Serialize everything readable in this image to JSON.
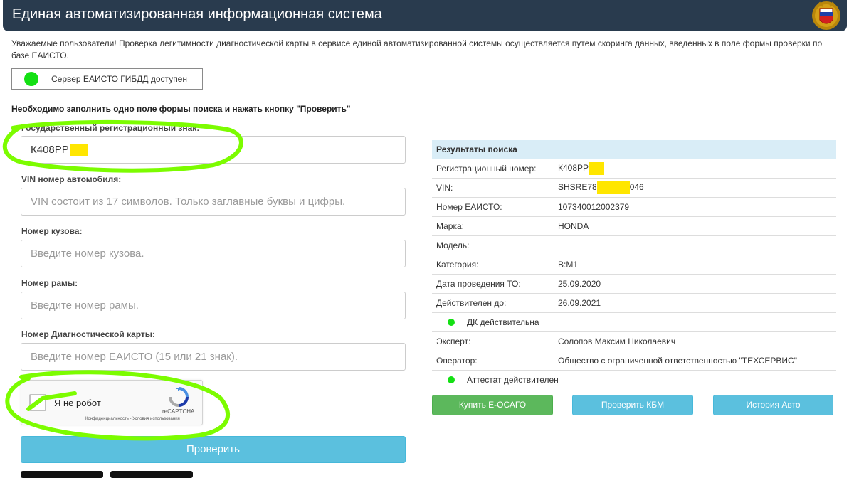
{
  "header": {
    "title": "Единая автоматизированная информационная система",
    "emblem_icon": "gibdd-emblem-icon"
  },
  "notice": "Уважаемые пользователи! Проверка легитимности диагностической карты в сервисе единой автоматизированной системы осуществляется путем скоринга данных, введенных в поле формы проверки по базе ЕАИСТО.",
  "server_status": {
    "text": "Сервер ЕАИСТО ГИБДД доступен",
    "status_color": "#14e014"
  },
  "instruction": "Необходимо заполнить одно поле формы поиска и нажать кнопку \"Проверить\"",
  "form": {
    "plate": {
      "label": "Государственный регистрационный знак:",
      "value": "К408РР"
    },
    "vin": {
      "label": "VIN номер автомобиля:",
      "placeholder": "VIN состоит из 17 символов. Только заглавные буквы и цифры."
    },
    "body": {
      "label": "Номер кузова:",
      "placeholder": "Введите номер кузова."
    },
    "frame": {
      "label": "Номер рамы:",
      "placeholder": "Введите номер рамы."
    },
    "card": {
      "label": "Номер Диагностической карты:",
      "placeholder": "Введите номер ЕАИСТО (15 или 21 знак)."
    },
    "captcha": {
      "label": "Я не робот",
      "brand": "reCAPTCHA",
      "links": "Конфиденциальность - Условия использования"
    },
    "submit_label": "Проверить"
  },
  "results": {
    "title": "Результаты поиска",
    "rows": [
      {
        "key": "Регистрационный номер:",
        "value": "К408РР"
      },
      {
        "key": "VIN:",
        "value_prefix": "SHSRE78",
        "value_suffix": "046"
      },
      {
        "key": "Номер ЕАИСТО:",
        "value": "107340012002379"
      },
      {
        "key": "Марка:",
        "value": "HONDA"
      },
      {
        "key": "Модель:",
        "value": ""
      },
      {
        "key": "Категория:",
        "value": "B:M1"
      },
      {
        "key": "Дата проведения ТО:",
        "value": "25.09.2020"
      },
      {
        "key": "Действителен до:",
        "value": "26.09.2021"
      },
      {
        "key": "Эксперт:",
        "value": "Солопов Максим Николаевич"
      },
      {
        "key": "Оператор:",
        "value": "Общество с ограниченной ответственностью \"ТЕХСЕРВИС\""
      }
    ],
    "card_status": "ДК действительна",
    "attestation_status": "Аттестат действителен"
  },
  "actions": {
    "osago_label": "Купить Е-ОСАГО",
    "kbm_label": "Проверить КБМ",
    "history_label": "История Авто"
  },
  "colors": {
    "header_bg": "#293b4e",
    "accent_blue": "#5bc0de",
    "accent_green": "#5cb85c",
    "highlight_yellow": "#ffe600",
    "annotation_green": "#7cfc00"
  }
}
